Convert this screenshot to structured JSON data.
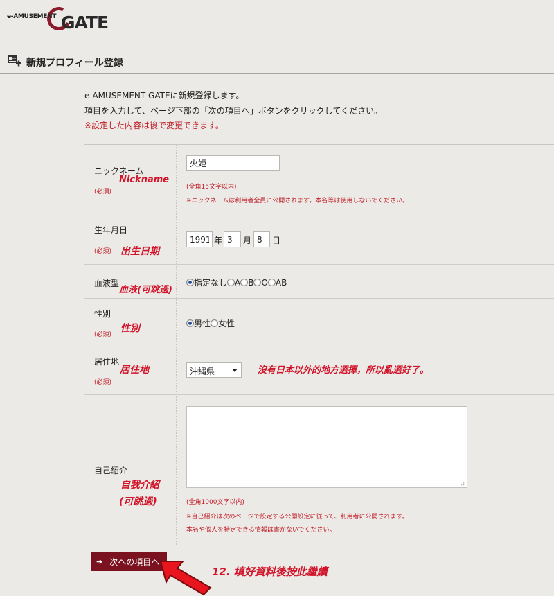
{
  "brand": {
    "small": "e-AMUSEMENT",
    "big": "GATE"
  },
  "section": {
    "title": "新規プロフィール登録"
  },
  "intro": {
    "line1": "e-AMUSEMENT GATEに新規登録します。",
    "line2": "項目を入力して、ページ下部の「次の項目へ」ボタンをクリックしてください。",
    "line3": "※設定した内容は後で変更できます。"
  },
  "form": {
    "nickname": {
      "label": "ニックネーム",
      "required": "(必須)",
      "value": "火姫",
      "note1": "(全角15文字以内)",
      "note2": "※ニックネームは利用者全員に公開されます。本名等は使用しないでください。",
      "annotation": "Nickname"
    },
    "birthday": {
      "label": "生年月日",
      "required": "(必須)",
      "year": "1991",
      "year_unit": "年",
      "month": "3",
      "month_unit": "月",
      "day": "8",
      "day_unit": "日",
      "annotation": "出生日期"
    },
    "blood": {
      "label": "血液型",
      "annotation": "血液(可跳過)",
      "options": [
        "指定なし",
        "A",
        "B",
        "O",
        "AB"
      ],
      "selected": "指定なし"
    },
    "gender": {
      "label": "性別",
      "required": "(必須)",
      "annotation": "性別",
      "options": [
        "男性",
        "女性"
      ],
      "selected": "男性"
    },
    "residence": {
      "label": "居住地",
      "required": "(必須)",
      "annotation": "居住地",
      "value": "沖縄県",
      "annotation2": "沒有日本以外的地方選擇，所以亂選好了。"
    },
    "self_intro": {
      "label": "自己紹介",
      "annotation1": "自我介紹",
      "annotation2": "(可跳過)",
      "value": "",
      "note1": "(全角1000文字以内)",
      "note2": "※自己紹介は次のページで設定する公開設定に従って、利用者に公開されます。",
      "note3": "本名や個人を特定できる情報は書かないでください。"
    }
  },
  "next_button": {
    "arrow": "➔",
    "label": "次への項目へ"
  },
  "step_annotation": "12. 填好資料後按此繼續",
  "colors": {
    "accent": "#7a1220",
    "note": "#c0202a",
    "annotation": "#d2142a",
    "arrow": "#e8141e"
  }
}
